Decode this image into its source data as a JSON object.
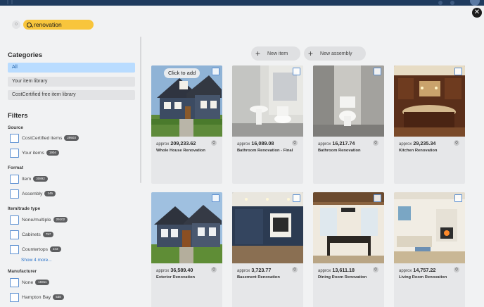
{
  "search": {
    "query": "renovation"
  },
  "sidebar": {
    "categories_title": "Categories",
    "categories": [
      {
        "label": "All",
        "active": true
      },
      {
        "label": "Your item library",
        "active": false
      },
      {
        "label": "CostCertified free item library",
        "active": false
      }
    ],
    "filters_title": "Filters",
    "groups": [
      {
        "title": "Source",
        "options": [
          {
            "label": "CostCertified items",
            "count": "29503"
          },
          {
            "label": "Your items",
            "count": "1904"
          }
        ]
      },
      {
        "title": "Format",
        "options": [
          {
            "label": "Item",
            "count": "30892"
          },
          {
            "label": "Assembly",
            "count": "145"
          }
        ]
      },
      {
        "title": "Item/trade type",
        "options": [
          {
            "label": "None/multiple",
            "count": "29102"
          },
          {
            "label": "Cabinets",
            "count": "757"
          },
          {
            "label": "Countertops",
            "count": "243"
          }
        ],
        "show_more": "Show 4 more..."
      },
      {
        "title": "Manufacturer",
        "options": [
          {
            "label": "None",
            "count": "19311"
          },
          {
            "label": "Hampton Bay",
            "count": "538"
          }
        ]
      }
    ]
  },
  "toolbar": {
    "new_item": "New item",
    "new_assembly": "New assembly",
    "click_to_add": "Click to add"
  },
  "cards": [
    {
      "approx": "approx",
      "price": "209,233.62",
      "name": "Whole House Renovation"
    },
    {
      "approx": "approx",
      "price": "16,089.08",
      "name": "Bathroom Renovation - Final"
    },
    {
      "approx": "approx",
      "price": "16,217.74",
      "name": "Bathroom Renovation"
    },
    {
      "approx": "approx",
      "price": "29,235.34",
      "name": "Kitchen Renovation"
    },
    {
      "approx": "approx",
      "price": "36,589.40",
      "name": "Exterior Renovation"
    },
    {
      "approx": "approx",
      "price": "3,723.77",
      "name": "Basement Renovation"
    },
    {
      "approx": "approx",
      "price": "13,611.18",
      "name": "Dining Room Renovation"
    },
    {
      "approx": "approx",
      "price": "14,757.22",
      "name": "Living Room Renovation"
    }
  ],
  "colors": {
    "accent": "#f8c53c",
    "selected_category": "#b9dcff",
    "checkbox": "#5b8fd1",
    "link": "#2a73c9"
  },
  "icons": {
    "close": "close-icon",
    "search": "search-icon",
    "add": "plus-icon",
    "card_action": "assembly-icon"
  }
}
